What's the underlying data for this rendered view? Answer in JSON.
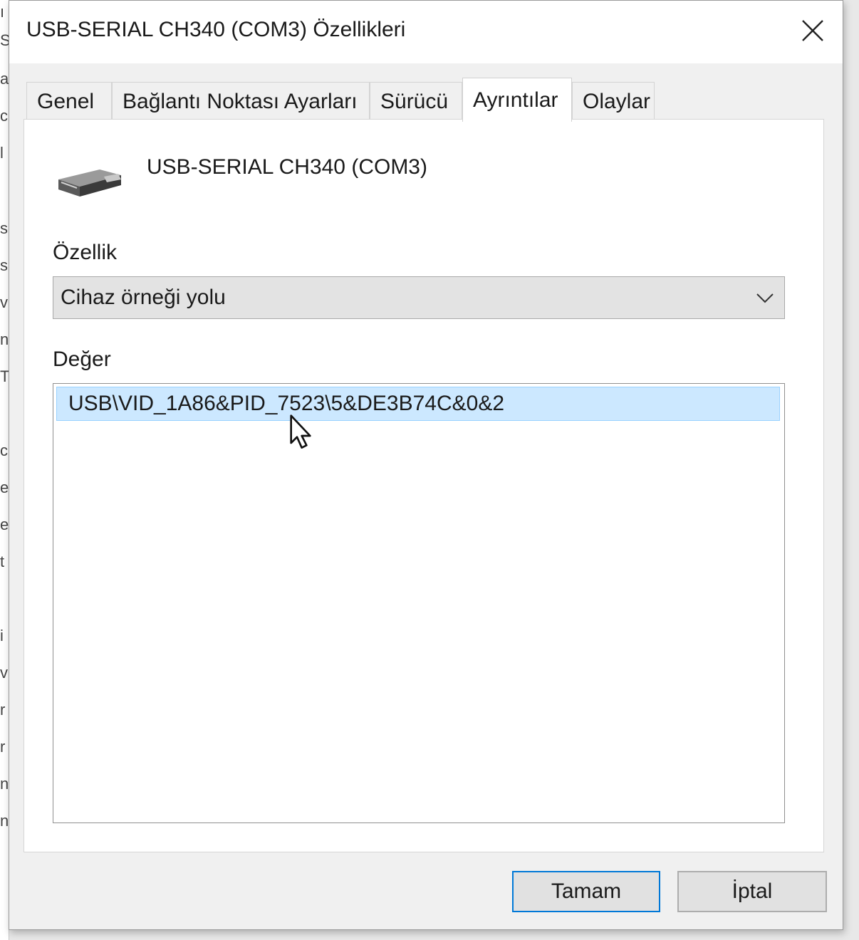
{
  "window": {
    "title": "USB-SERIAL CH340 (COM3) Özellikleri"
  },
  "tabs": [
    {
      "label": "Genel"
    },
    {
      "label": "Bağlantı Noktası Ayarları"
    },
    {
      "label": "Sürücü"
    },
    {
      "label": "Ayrıntılar"
    },
    {
      "label": "Olaylar"
    }
  ],
  "active_tab": "Ayrıntılar",
  "device": {
    "name": "USB-SERIAL CH340 (COM3)",
    "icon": "usb-serial-device-icon"
  },
  "property": {
    "label": "Özellik",
    "selected": "Cihaz örneği yolu"
  },
  "value": {
    "label": "Değer",
    "items": [
      "USB\\VID_1A86&PID_7523\\5&DE3B74C&0&2"
    ]
  },
  "buttons": {
    "ok": "Tamam",
    "cancel": "İptal"
  },
  "colors": {
    "selection": "#cce8ff",
    "accent": "#0078d7"
  },
  "icons": [
    "close-icon",
    "chevron-down-icon",
    "usb-serial-device-icon",
    "mouse-cursor-icon"
  ]
}
